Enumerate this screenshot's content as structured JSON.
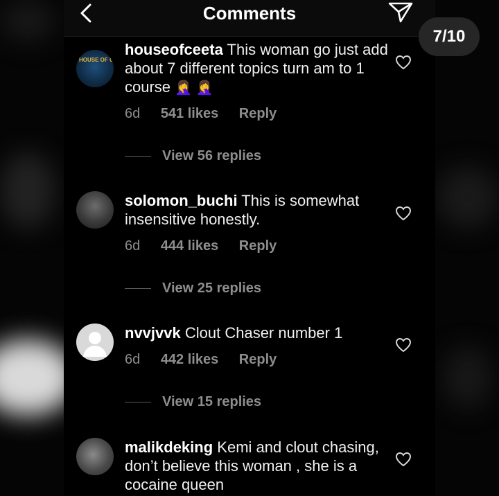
{
  "header": {
    "title": "Comments",
    "back_icon": "chevron-left-icon",
    "send_icon": "paper-plane-icon"
  },
  "badge": {
    "page": "7/10"
  },
  "comments": [
    {
      "username": "houseofceeta",
      "text": "This woman go just add about 7 different topics turn am to 1 course",
      "emoji": "🤦‍♀️ 🤦‍♀️",
      "avatar_text": "HOUSE OF CEE",
      "age": "6d",
      "likes": "541 likes",
      "reply": "Reply",
      "view_replies": "View 56 replies"
    },
    {
      "username": "solomon_buchi",
      "text": "This is somewhat insensitive honestly.",
      "age": "6d",
      "likes": "444 likes",
      "reply": "Reply",
      "view_replies": "View 25 replies"
    },
    {
      "username": "nvvjvvk",
      "text": "Clout Chaser number 1",
      "age": "6d",
      "likes": "442 likes",
      "reply": "Reply",
      "view_replies": "View 15 replies"
    },
    {
      "username": "malikdeking",
      "text": "Kemi and clout chasing, don’t believe this woman , she is a cocaine queen"
    }
  ],
  "colors": {
    "background": "#000000",
    "text": "#f0f0f0",
    "muted": "#8e8e8e",
    "badge": "#262626"
  }
}
